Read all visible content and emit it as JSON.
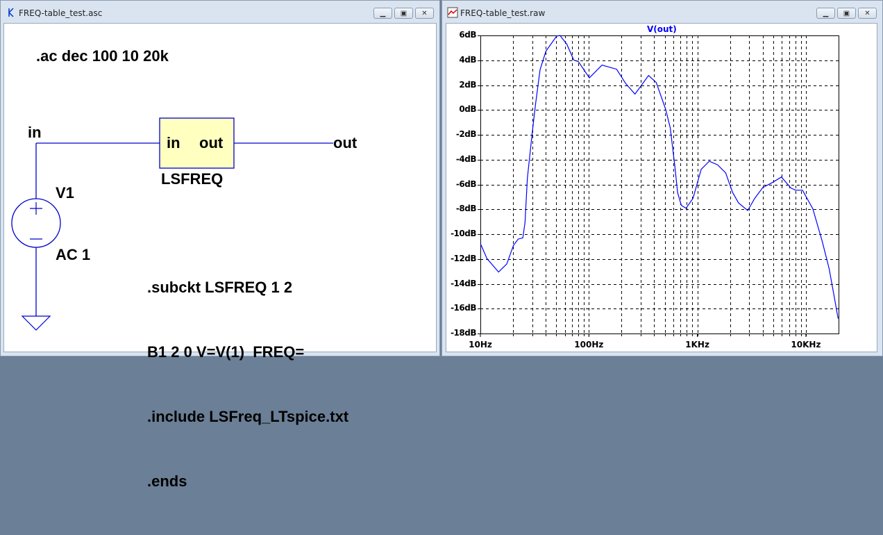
{
  "schematic_window": {
    "title": "FREQ-table_test.asc",
    "directive_ac": ".ac dec 100 10 20k",
    "net_in": "in",
    "net_out": "out",
    "block": {
      "pin_in": "in",
      "pin_out": "out",
      "name": "LSFREQ"
    },
    "source": {
      "name": "V1",
      "value": "AC 1"
    },
    "netlist": [
      ".subckt LSFREQ 1 2",
      "B1 2 0 V=V(1)  FREQ=",
      ".include LSFreq_LTspice.txt",
      ".ends"
    ],
    "colors": {
      "wire": "#0000cc",
      "block_fill": "#ffffc0"
    }
  },
  "plot_window": {
    "title": "FREQ-table_test.raw",
    "trace_label": "V(out)"
  },
  "window_buttons": {
    "minimize": "minimize-icon",
    "maximize": "maximize-icon",
    "close": "close-icon"
  },
  "chart_data": {
    "type": "line",
    "title": "V(out)",
    "xscale": "log",
    "xlim": [
      10,
      20000
    ],
    "ylim": [
      -18,
      6
    ],
    "grid": true,
    "y_ticks": [
      "6dB",
      "4dB",
      "2dB",
      "0dB",
      "-2dB",
      "-4dB",
      "-6dB",
      "-8dB",
      "-10dB",
      "-12dB",
      "-14dB",
      "-16dB",
      "-18dB"
    ],
    "y_tick_values": [
      6,
      4,
      2,
      0,
      -2,
      -4,
      -6,
      -8,
      -10,
      -12,
      -14,
      -16,
      -18
    ],
    "x_ticks": [
      "10Hz",
      "100Hz",
      "1KHz",
      "10KHz"
    ],
    "x_tick_values": [
      10,
      100,
      1000,
      10000
    ],
    "series": [
      {
        "name": "V(out)",
        "color": "#0000ff",
        "x": [
          10,
          11.5,
          14.7,
          17.5,
          20.2,
          22.3,
          24.6,
          25.8,
          27.1,
          29.9,
          32.2,
          35.5,
          40.2,
          50.3,
          54.2,
          62.7,
          72.5,
          80,
          101,
          132,
          180,
          219,
          266,
          355,
          417,
          509,
          562,
          621,
          657,
          711,
          785,
          911,
          1084,
          1286,
          1531,
          1821,
          2114,
          2393,
          2907,
          3376,
          4012,
          4775,
          5950,
          7260,
          8020,
          9300,
          11580,
          14130,
          16400,
          18550,
          19760,
          20000
        ],
        "y": [
          -10.75,
          -11.97,
          -13.05,
          -12.4,
          -10.9,
          -10.4,
          -10.3,
          -9.07,
          -5.5,
          -1.99,
          0.44,
          3.24,
          4.73,
          5.94,
          6.0,
          5.29,
          4.02,
          3.89,
          2.59,
          3.61,
          3.28,
          2.12,
          1.28,
          2.77,
          2.21,
          0.07,
          -1.43,
          -4.6,
          -6.65,
          -7.68,
          -7.92,
          -7.12,
          -4.78,
          -4.13,
          -4.41,
          -5.06,
          -6.65,
          -7.49,
          -8.1,
          -7.12,
          -6.24,
          -5.9,
          -5.4,
          -6.28,
          -6.46,
          -6.46,
          -7.96,
          -10.57,
          -12.8,
          -15.4,
          -16.76,
          -16.76
        ]
      }
    ]
  }
}
